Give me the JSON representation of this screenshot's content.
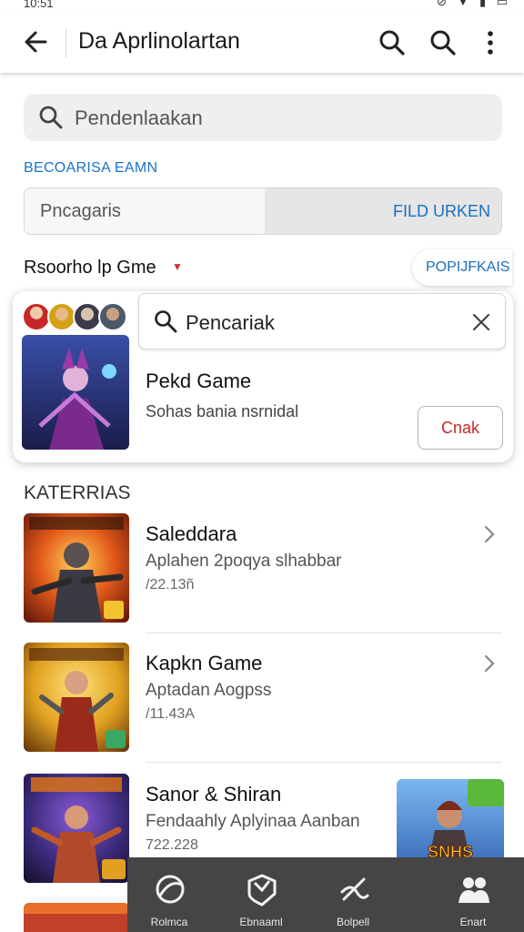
{
  "status_bar": {
    "time": "10:51",
    "icons": "⊘ ▼ ▮ ▭"
  },
  "app_bar": {
    "title": "Da Aprlinolartan"
  },
  "search": {
    "placeholder": "Pendenlaakan"
  },
  "section_link": "BECOARISA EAMN",
  "filter": {
    "label": "Pncagaris",
    "action": "FILD URKEN"
  },
  "sort": {
    "label": "Rsoorho lp Gme",
    "popular": "POPIJFKAIS"
  },
  "featured": {
    "search_value": "Pencariak",
    "title": "Pekd Game",
    "subtitle": "Sohas bania nsrnidal",
    "cta": "Cnak"
  },
  "section_heading": "KATERRIAS",
  "games": [
    {
      "name": "Saleddara",
      "desc": "Aplahen 2poqya slhabbar",
      "meta": "/22.13ñ"
    },
    {
      "name": "Kapkn Game",
      "desc": "Aptadan Aogpss",
      "meta": "/11.43A"
    },
    {
      "name": "Sanor & Shiran",
      "desc": "Fendaahly Aplyinaa Aanban",
      "meta": "722.228"
    }
  ],
  "side_thumb_label": "SNHS",
  "nav": [
    {
      "label": "Rolmca",
      "icon": "globe-icon"
    },
    {
      "label": "Ebnaaml",
      "icon": "shield-icon"
    },
    {
      "label": "Bolpell",
      "icon": "pen-icon"
    },
    {
      "label": "Enart",
      "icon": "users-icon"
    }
  ],
  "colors": {
    "accent": "#1a73c8",
    "danger": "#c62828",
    "nav_bg": "#454545"
  }
}
